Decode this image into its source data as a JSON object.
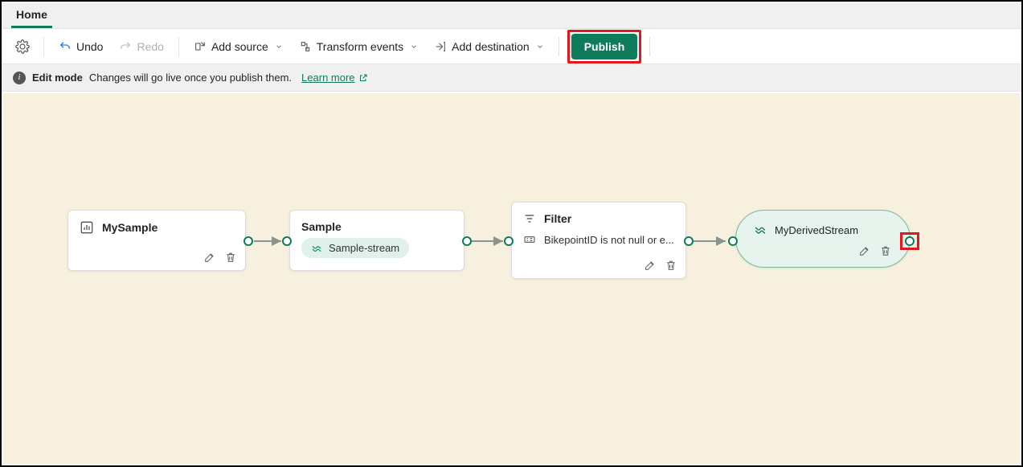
{
  "tabs": {
    "home": "Home"
  },
  "toolbar": {
    "undo": "Undo",
    "redo": "Redo",
    "add_source": "Add source",
    "transform_events": "Transform events",
    "add_destination": "Add destination",
    "publish": "Publish"
  },
  "infobar": {
    "mode": "Edit mode",
    "message": "Changes will go live once you publish them.",
    "learn_more": "Learn more"
  },
  "nodes": {
    "mysample": {
      "title": "MySample"
    },
    "sample": {
      "title": "Sample",
      "chip": "Sample-stream"
    },
    "filter": {
      "title": "Filter",
      "expr": "BikepointID is not null or e..."
    },
    "dest": {
      "title": "MyDerivedStream"
    }
  }
}
